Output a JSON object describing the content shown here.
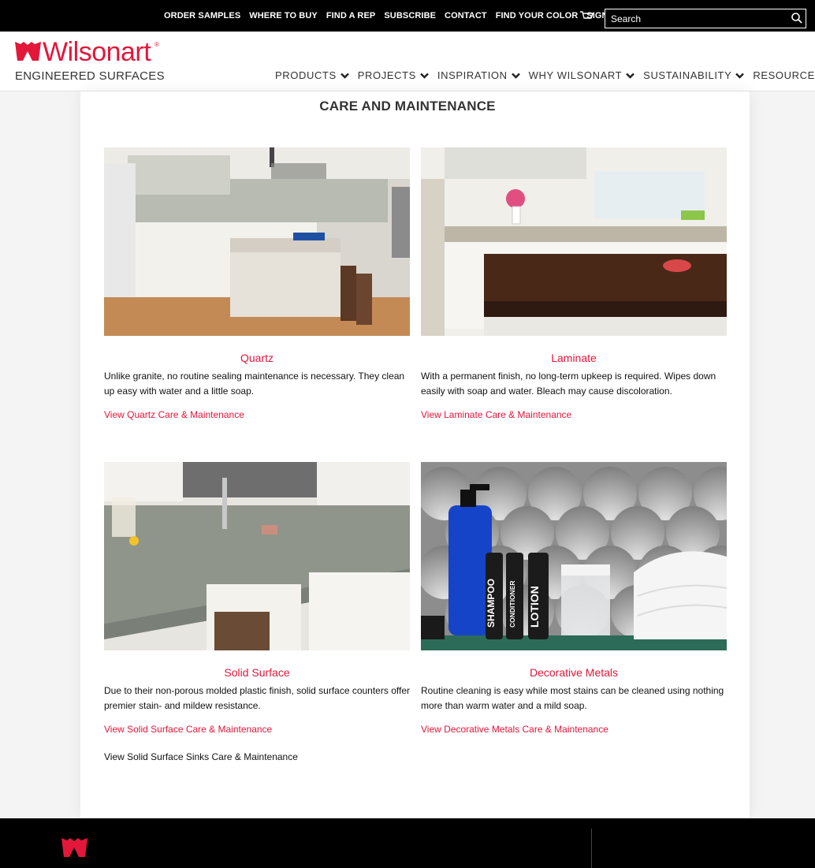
{
  "topnav": {
    "links": [
      "ORDER SAMPLES",
      "WHERE TO BUY",
      "FIND A REP",
      "SUBSCRIBE",
      "CONTACT",
      "FIND YOUR COLOR",
      "SIGN IN"
    ],
    "search_placeholder": "Search",
    "cart_icon": "cart-icon",
    "search_icon": "magnifier-icon"
  },
  "brand": {
    "name": "Wilsonart",
    "registered": "®",
    "tagline": "ENGINEERED SURFACES",
    "color": "#e2173a"
  },
  "mainnav": {
    "items": [
      "PRODUCTS",
      "PROJECTS",
      "INSPIRATION",
      "WHY WILSONART",
      "SUSTAINABILITY",
      "RESOURCES"
    ],
    "dropdown_icon": "chevron-down-icon"
  },
  "page": {
    "title": "CARE AND MAINTENANCE"
  },
  "tiles": [
    {
      "title": "Quartz",
      "description": "Unlike granite, no routine sealing maintenance is necessary. They clean up easy with water and a little soap.",
      "link": "View Quartz Care & Maintenance"
    },
    {
      "title": "Laminate",
      "description": "With a permanent finish, no long-term upkeep is required. Wipes down easily with soap and water. Bleach may cause discoloration.",
      "link": "View Laminate Care & Maintenance"
    },
    {
      "title": "Solid Surface",
      "description": "Due to their non-porous molded plastic finish, solid surface counters offer premier stain- and mildew resistance.",
      "link": "View Solid Surface Care & Maintenance",
      "link2": "View Solid Surface Sinks Care & Maintenance"
    },
    {
      "title": "Decorative Metals",
      "description": "Routine cleaning is easy while most stains can be cleaned using nothing more than warm water and a mild soap.",
      "link": "View Decorative Metals Care & Maintenance",
      "bottle_labels": [
        "SHAMPOO",
        "CONDITIONER",
        "LOTION"
      ]
    }
  ]
}
